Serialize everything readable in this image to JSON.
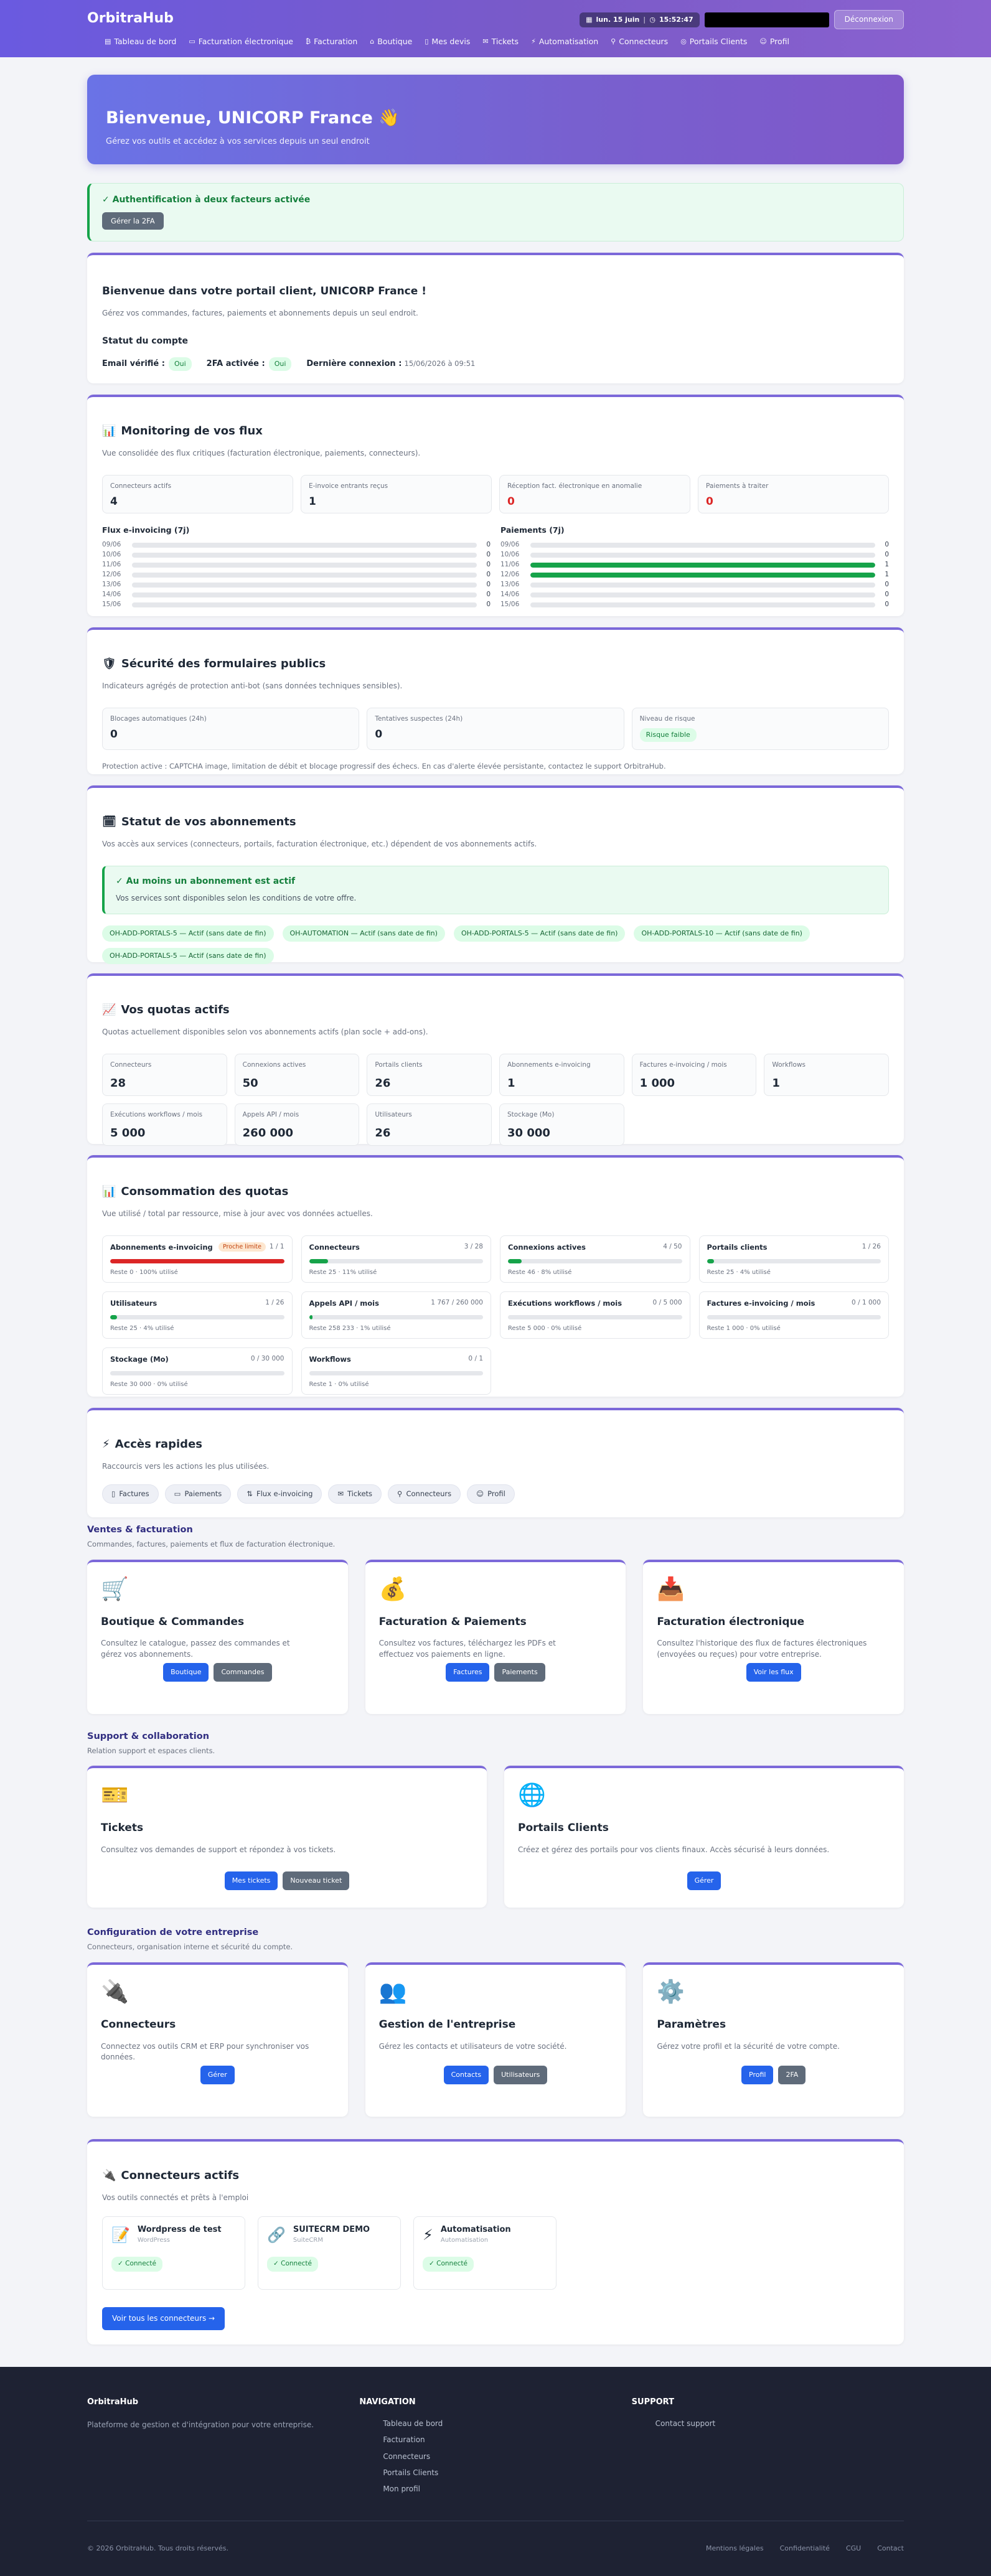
{
  "header": {
    "brand": "OrbitraHub",
    "date": "lun. 15 juin",
    "time": "15:52:47",
    "logout": "Déconnexion",
    "nav": [
      {
        "icon": "▤",
        "label": "Tableau de bord"
      },
      {
        "icon": "▭",
        "label": "Facturation électronique"
      },
      {
        "icon": "₿",
        "label": "Facturation"
      },
      {
        "icon": "⌂",
        "label": "Boutique"
      },
      {
        "icon": "▯",
        "label": "Mes devis"
      },
      {
        "icon": "✉",
        "label": "Tickets"
      },
      {
        "icon": "⚡",
        "label": "Automatisation"
      },
      {
        "icon": "⚲",
        "label": "Connecteurs"
      },
      {
        "icon": "◎",
        "label": "Portails Clients"
      },
      {
        "icon": "☺",
        "label": "Profil"
      }
    ]
  },
  "hero": {
    "title": "Bienvenue, UNICORP France 👋",
    "subtitle": "Gérez vos outils et accédez à vos services depuis un seul endroit"
  },
  "tfa": {
    "title": "✓ Authentification à deux facteurs activée",
    "button": "Gérer la 2FA"
  },
  "welcome": {
    "title": "Bienvenue dans votre portail client, UNICORP France !",
    "subtitle": "Gérez vos commandes, factures, paiements et abonnements depuis un seul endroit.",
    "status_title": "Statut du compte",
    "email_label": "Email vérifié :",
    "email_value": "Oui",
    "tfa_label": "2FA activée :",
    "tfa_value": "Oui",
    "last_label": "Dernière connexion :",
    "last_value": "15/06/2026 à 09:51"
  },
  "monitoring": {
    "title": "Monitoring de vos flux",
    "icon": "📊",
    "subtitle": "Vue consolidée des flux critiques (facturation électronique, paiements, connecteurs).",
    "kpis": [
      {
        "label": "Connecteurs actifs",
        "value": "4",
        "color": "#1f2937"
      },
      {
        "label": "E-invoice entrants reçus",
        "value": "1",
        "color": "#1f2937"
      },
      {
        "label": "Réception fact. électronique en anomalie",
        "value": "0",
        "color": "#dc2626"
      },
      {
        "label": "Paiements à traiter",
        "value": "0",
        "color": "#dc2626"
      }
    ],
    "flux_title": "Flux e-invoicing (7j)",
    "pay_title": "Paiements (7j)",
    "flux": [
      {
        "d": "09/06",
        "v": "0",
        "fill": 0
      },
      {
        "d": "10/06",
        "v": "0",
        "fill": 0
      },
      {
        "d": "11/06",
        "v": "0",
        "fill": 0
      },
      {
        "d": "12/06",
        "v": "0",
        "fill": 0
      },
      {
        "d": "13/06",
        "v": "0",
        "fill": 0
      },
      {
        "d": "14/06",
        "v": "0",
        "fill": 0
      },
      {
        "d": "15/06",
        "v": "0",
        "fill": 0
      }
    ],
    "pay": [
      {
        "d": "09/06",
        "v": "0",
        "fill": 0
      },
      {
        "d": "10/06",
        "v": "0",
        "fill": 0
      },
      {
        "d": "11/06",
        "v": "1",
        "fill": 1
      },
      {
        "d": "12/06",
        "v": "1",
        "fill": 1
      },
      {
        "d": "13/06",
        "v": "0",
        "fill": 0
      },
      {
        "d": "14/06",
        "v": "0",
        "fill": 0
      },
      {
        "d": "15/06",
        "v": "0",
        "fill": 0
      }
    ]
  },
  "security": {
    "title": "Sécurité des formulaires publics",
    "icon": "🛡",
    "subtitle": "Indicateurs agrégés de protection anti-bot (sans données techniques sensibles).",
    "blocks_label": "Blocages automatiques (24h)",
    "blocks_value": "0",
    "attempts_label": "Tentatives suspectes (24h)",
    "attempts_value": "0",
    "risk_label": "Niveau de risque",
    "risk_value": "Risque faible",
    "note": "Protection active : CAPTCHA image, limitation de débit et blocage progressif des échecs. En cas d'alerte élevée persistante, contactez le support OrbitraHub."
  },
  "subs": {
    "title": "Statut de vos abonnements",
    "icon": "🗓",
    "subtitle": "Vos accès aux services (connecteurs, portails, facturation électronique, etc.) dépendent de vos abonnements actifs.",
    "alert_title": "✓ Au moins un abonnement est actif",
    "alert_sub": "Vos services sont disponibles selon les conditions de votre offre.",
    "tags": [
      "OH-ADD-PORTALS-5 — Actif (sans date de fin)",
      "OH-AUTOMATION — Actif (sans date de fin)",
      "OH-ADD-PORTALS-5 — Actif (sans date de fin)",
      "OH-ADD-PORTALS-10 — Actif (sans date de fin)",
      "OH-ADD-PORTALS-5 — Actif (sans date de fin)"
    ]
  },
  "quotas": {
    "title": "Vos quotas actifs",
    "icon": "📈",
    "subtitle": "Quotas actuellement disponibles selon vos abonnements actifs (plan socle + add-ons).",
    "items": [
      {
        "label": "Connecteurs",
        "value": "28"
      },
      {
        "label": "Connexions actives",
        "value": "50"
      },
      {
        "label": "Portails clients",
        "value": "26"
      },
      {
        "label": "Abonnements e-invoicing",
        "value": "1"
      },
      {
        "label": "Factures e-invoicing / mois",
        "value": "1 000"
      },
      {
        "label": "Workflows",
        "value": "1"
      },
      {
        "label": "Exécutions workflows / mois",
        "value": "5 000"
      },
      {
        "label": "Appels API / mois",
        "value": "260 000"
      },
      {
        "label": "Utilisateurs",
        "value": "26"
      },
      {
        "label": "Stockage (Mo)",
        "value": "30 000"
      }
    ]
  },
  "consumption": {
    "title": "Consommation des quotas",
    "icon": "📊",
    "subtitle": "Vue utilisé / total par ressource, mise à jour avec vos données actuelles.",
    "limit_badge": "Proche limite",
    "items": [
      {
        "name": "Abonnements e-invoicing",
        "ratio": "1 / 1",
        "pct": 100,
        "rest": "Reste 0 · 100% utilisé",
        "limit": true
      },
      {
        "name": "Connecteurs",
        "ratio": "3 / 28",
        "pct": 11,
        "rest": "Reste 25 · 11% utilisé",
        "limit": false
      },
      {
        "name": "Connexions actives",
        "ratio": "4 / 50",
        "pct": 8,
        "rest": "Reste 46 · 8% utilisé",
        "limit": false
      },
      {
        "name": "Portails clients",
        "ratio": "1 / 26",
        "pct": 4,
        "rest": "Reste 25 · 4% utilisé",
        "limit": false
      },
      {
        "name": "Utilisateurs",
        "ratio": "1 / 26",
        "pct": 4,
        "rest": "Reste 25 · 4% utilisé",
        "limit": false
      },
      {
        "name": "Appels API / mois",
        "ratio": "1 767 / 260 000",
        "pct": 1,
        "rest": "Reste 258 233 · 1% utilisé",
        "limit": false
      },
      {
        "name": "Exécutions workflows / mois",
        "ratio": "0 / 5 000",
        "pct": 0,
        "rest": "Reste 5 000 · 0% utilisé",
        "limit": false
      },
      {
        "name": "Factures e-invoicing / mois",
        "ratio": "0 / 1 000",
        "pct": 0,
        "rest": "Reste 1 000 · 0% utilisé",
        "limit": false
      },
      {
        "name": "Stockage (Mo)",
        "ratio": "0 / 30 000",
        "pct": 0,
        "rest": "Reste 30 000 · 0% utilisé",
        "limit": false
      },
      {
        "name": "Workflows",
        "ratio": "0 / 1",
        "pct": 0,
        "rest": "Reste 1 · 0% utilisé",
        "limit": false
      }
    ]
  },
  "quick": {
    "title": "Accès rapides",
    "icon": "⚡",
    "subtitle": "Raccourcis vers les actions les plus utilisées.",
    "items": [
      {
        "icon": "▯",
        "label": "Factures"
      },
      {
        "icon": "▭",
        "label": "Paiements"
      },
      {
        "icon": "⇅",
        "label": "Flux e-invoicing"
      },
      {
        "icon": "✉",
        "label": "Tickets"
      },
      {
        "icon": "⚲",
        "label": "Connecteurs"
      },
      {
        "icon": "☺",
        "label": "Profil"
      }
    ]
  },
  "sales": {
    "title": "Ventes & facturation",
    "subtitle": "Commandes, factures, paiements et flux de facturation électronique.",
    "cards": [
      {
        "icon": "🛒",
        "title": "Boutique & Commandes",
        "desc": "Consultez le catalogue, passez des commandes et gérez vos abonnements.",
        "btn1": "Boutique",
        "btn2": "Commandes"
      },
      {
        "icon": "💰",
        "title": "Facturation & Paiements",
        "desc": "Consultez vos factures, téléchargez les PDFs et effectuez vos paiements en ligne.",
        "btn1": "Factures",
        "btn2": "Paiements"
      },
      {
        "icon": "📥",
        "title": "Facturation électronique",
        "desc": "Consultez l'historique des flux de factures électroniques (envoyées ou reçues) pour votre entreprise.",
        "btn1": "Voir les flux"
      }
    ]
  },
  "support": {
    "title": "Support & collaboration",
    "subtitle": "Relation support et espaces clients.",
    "cards": [
      {
        "icon": "🎫",
        "title": "Tickets",
        "desc": "Consultez vos demandes de support et répondez à vos tickets.",
        "btn1": "Mes tickets",
        "btn2": "Nouveau ticket"
      },
      {
        "icon": "🌐",
        "title": "Portails Clients",
        "desc": "Créez et gérez des portails pour vos clients finaux. Accès sécurisé à leurs données.",
        "btn1": "Gérer"
      }
    ]
  },
  "config": {
    "title": "Configuration de votre entreprise",
    "subtitle": "Connecteurs, organisation interne et sécurité du compte.",
    "cards": [
      {
        "icon": "🔌",
        "title": "Connecteurs",
        "desc": "Connectez vos outils CRM et ERP pour synchroniser vos données.",
        "btn1": "Gérer"
      },
      {
        "icon": "👥",
        "title": "Gestion de l'entreprise",
        "desc": "Gérez les contacts et utilisateurs de votre société.",
        "btn1": "Contacts",
        "btn2": "Utilisateurs"
      },
      {
        "icon": "⚙️",
        "title": "Paramètres",
        "desc": "Gérez votre profil et la sécurité de votre compte.",
        "btn1": "Profil",
        "btn2": "2FA"
      }
    ]
  },
  "connectors": {
    "title": "Connecteurs actifs",
    "icon": "🔌",
    "subtitle": "Vos outils connectés et prêts à l'emploi",
    "items": [
      {
        "icon": "📝",
        "name": "Wordpress de test",
        "type": "WordPress",
        "status": "✓ Connecté"
      },
      {
        "icon": "🔗",
        "name": "SUITECRM DEMO",
        "type": "SuiteCRM",
        "status": "✓ Connecté"
      },
      {
        "icon": "⚡",
        "name": "Automatisation",
        "type": "Automatisation",
        "status": "✓ Connecté"
      }
    ],
    "all_button": "Voir tous les connecteurs →"
  },
  "footer": {
    "brand": "OrbitraHub",
    "desc": "Plateforme de gestion et d'intégration pour votre entreprise.",
    "nav_title": "NAVIGATION",
    "nav": [
      "Tableau de bord",
      "Facturation",
      "Connecteurs",
      "Portails Clients",
      "Mon profil"
    ],
    "support_title": "SUPPORT",
    "support": [
      "Contact support"
    ],
    "copyright": "© 2026 OrbitraHub. Tous droits réservés.",
    "links": [
      "Mentions légales",
      "Confidentialité",
      "CGU",
      "Contact"
    ]
  }
}
